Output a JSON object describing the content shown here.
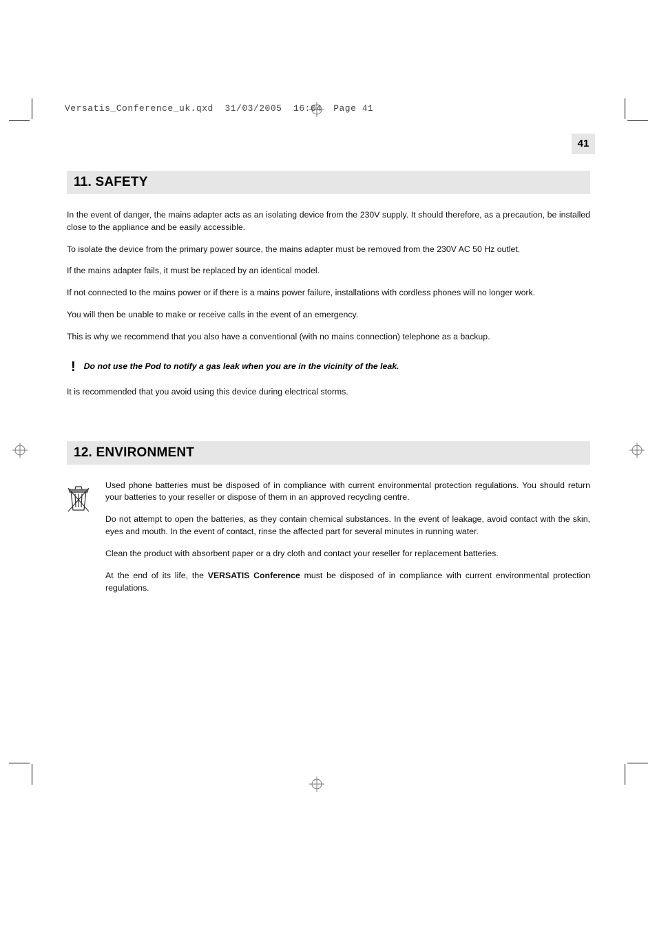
{
  "header": {
    "filename": "Versatis_Conference_uk.qxd",
    "date": "31/03/2005",
    "time": "16:04",
    "page_label": "Page 41"
  },
  "page_number": "41",
  "section_safety": {
    "heading": "11. SAFETY",
    "p1": "In the event of danger, the mains adapter acts as an isolating device from the 230V supply. It should therefore, as a precaution, be installed close to the appliance and be easily accessible.",
    "p2": "To isolate the device from the primary power source, the mains adapter must be removed from the 230V AC 50 Hz outlet.",
    "p3": "If the mains adapter fails, it must be replaced by an identical model.",
    "p4": "If not connected to the mains power or if there is a mains power failure, installations with cordless phones will no longer work.",
    "p5": "You will then be unable to make or receive calls in the event of an emergency.",
    "p6": "This is why we recommend that you also have a conventional (with no mains connection) telephone as a backup.",
    "warning": "Do not use the Pod to notify a gas leak when you are in the vicinity of the leak.",
    "p7": "It is recommended that you avoid using this device during electrical storms."
  },
  "section_env": {
    "heading": "12. ENVIRONMENT",
    "p1": "Used phone batteries must be disposed of in compliance with current environmental protection regulations. You should return your batteries to your reseller or dispose of them in an approved recycling centre.",
    "p2": "Do not attempt to open the batteries, as they contain chemical substances. In the event of leakage, avoid contact with the skin, eyes and mouth. In the event of contact, rinse the affected part for several minutes in running water.",
    "p3": "Clean the product with absorbent paper or a dry cloth and contact your reseller for replacement batteries.",
    "p4_pre": "At the end of its life, the ",
    "p4_bold": "VERSATIS Conference",
    "p4_post": " must be disposed of in compliance with current environmental protection regulations."
  }
}
